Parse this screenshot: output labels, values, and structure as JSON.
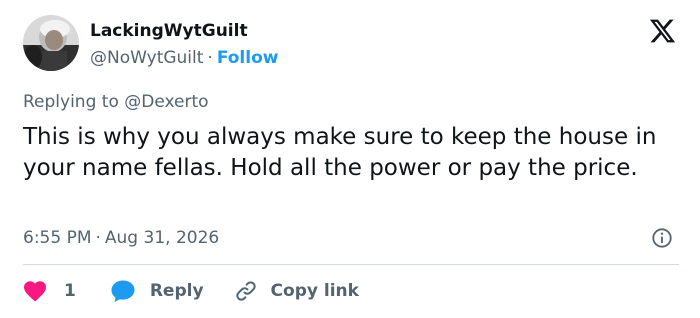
{
  "author": {
    "display_name": "LackingWytGuilt",
    "handle": "@NoWytGuilt",
    "separator": "·",
    "follow_label": "Follow",
    "avatar_icon": "profile-photo"
  },
  "reply_context": {
    "prefix": "Replying to",
    "mention": "@Dexerto"
  },
  "tweet": {
    "text": "This is why you always make sure to keep the house in your name fellas. Hold all the power or pay the price.",
    "time": "6:55 PM",
    "separator": "·",
    "date": "Aug 31, 2026"
  },
  "actions": {
    "like_count": "1",
    "reply_label": "Reply",
    "copy_label": "Copy link"
  },
  "icons": {
    "logo": "x-logo-icon",
    "info": "info-icon",
    "like": "heart-icon",
    "reply": "speech-bubble-icon",
    "copy": "link-icon"
  },
  "colors": {
    "text": "#0f1419",
    "secondary": "#536471",
    "follow": "#1d9bf0",
    "heart": "#f91880",
    "reply_bubble": "#1d9bf0",
    "divider": "#cfd9de"
  }
}
